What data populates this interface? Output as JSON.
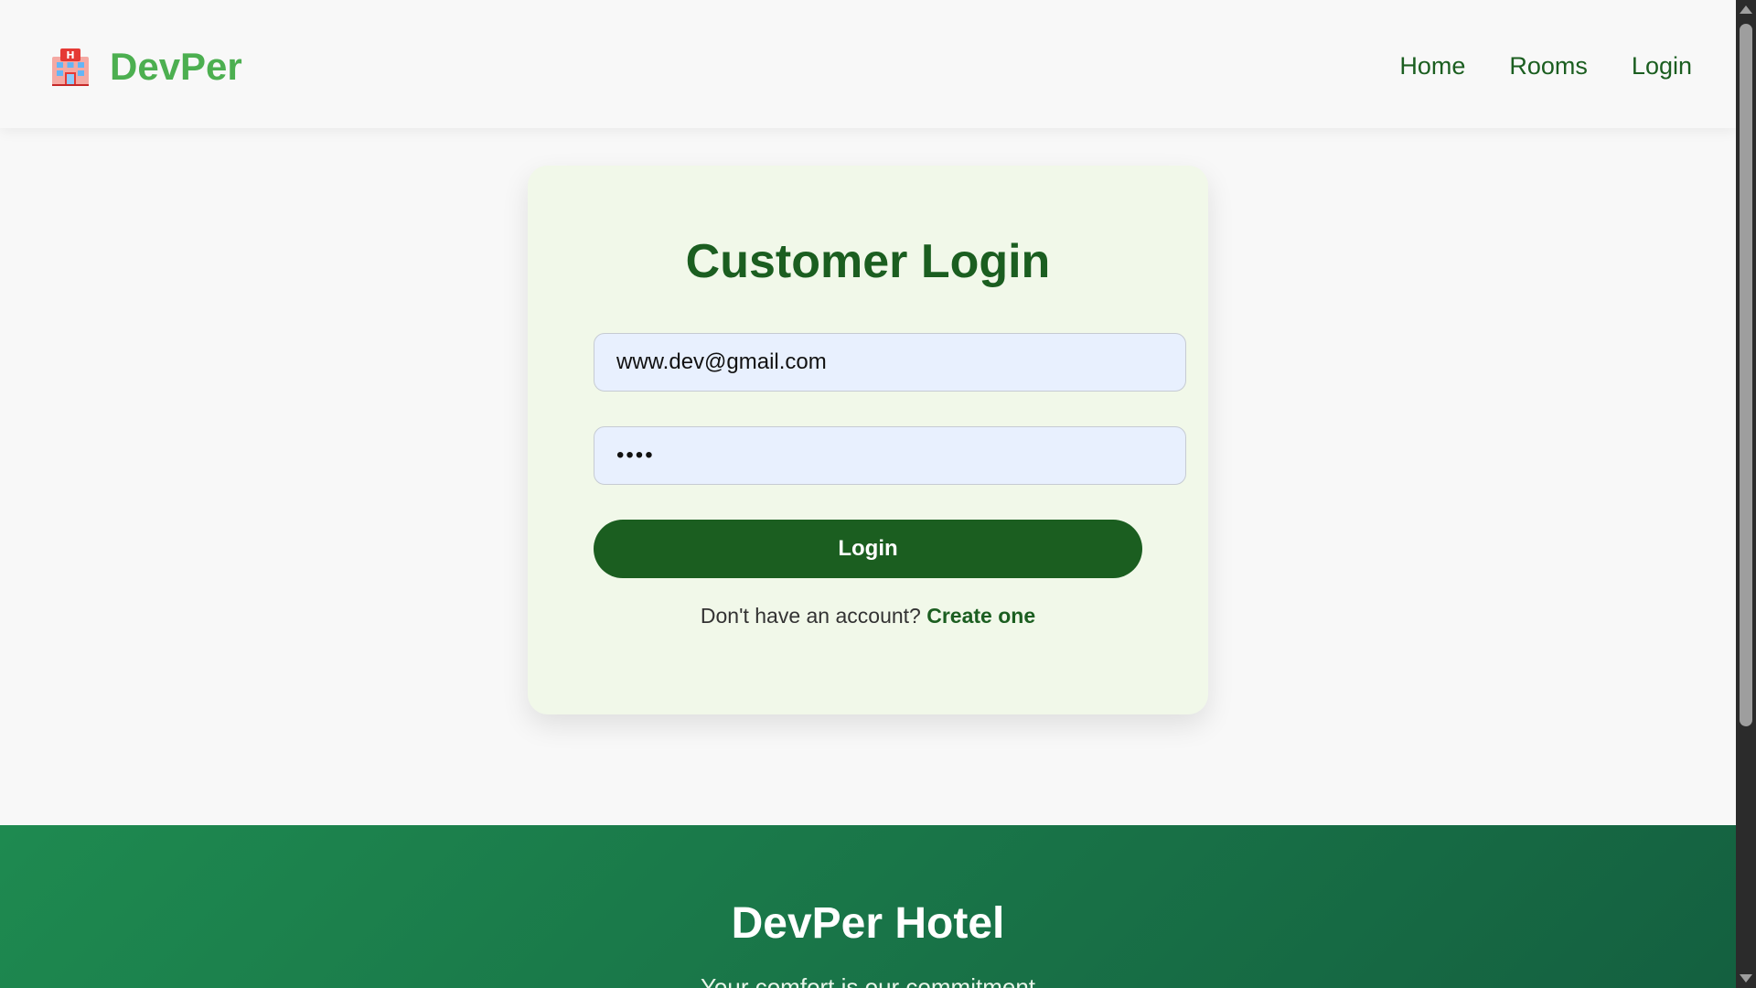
{
  "header": {
    "logo_icon": "hotel-icon",
    "brand_name": "DevPer",
    "nav": {
      "home": "Home",
      "rooms": "Rooms",
      "login": "Login"
    }
  },
  "login_form": {
    "title": "Customer Login",
    "email_value": "www.dev@gmail.com",
    "password_value": "1234",
    "submit_label": "Login",
    "signup_prompt": "Don't have an account?",
    "signup_link": "Create one"
  },
  "footer": {
    "title": "DevPer Hotel",
    "tagline": "Your comfort is our commitment"
  },
  "colors": {
    "brand_green": "#4caf50",
    "dark_green": "#1b5e20",
    "card_background": "#f1f8e9",
    "input_background": "#e8f0fe",
    "footer_gradient_start": "#1e8a50",
    "footer_gradient_end": "#146040"
  }
}
